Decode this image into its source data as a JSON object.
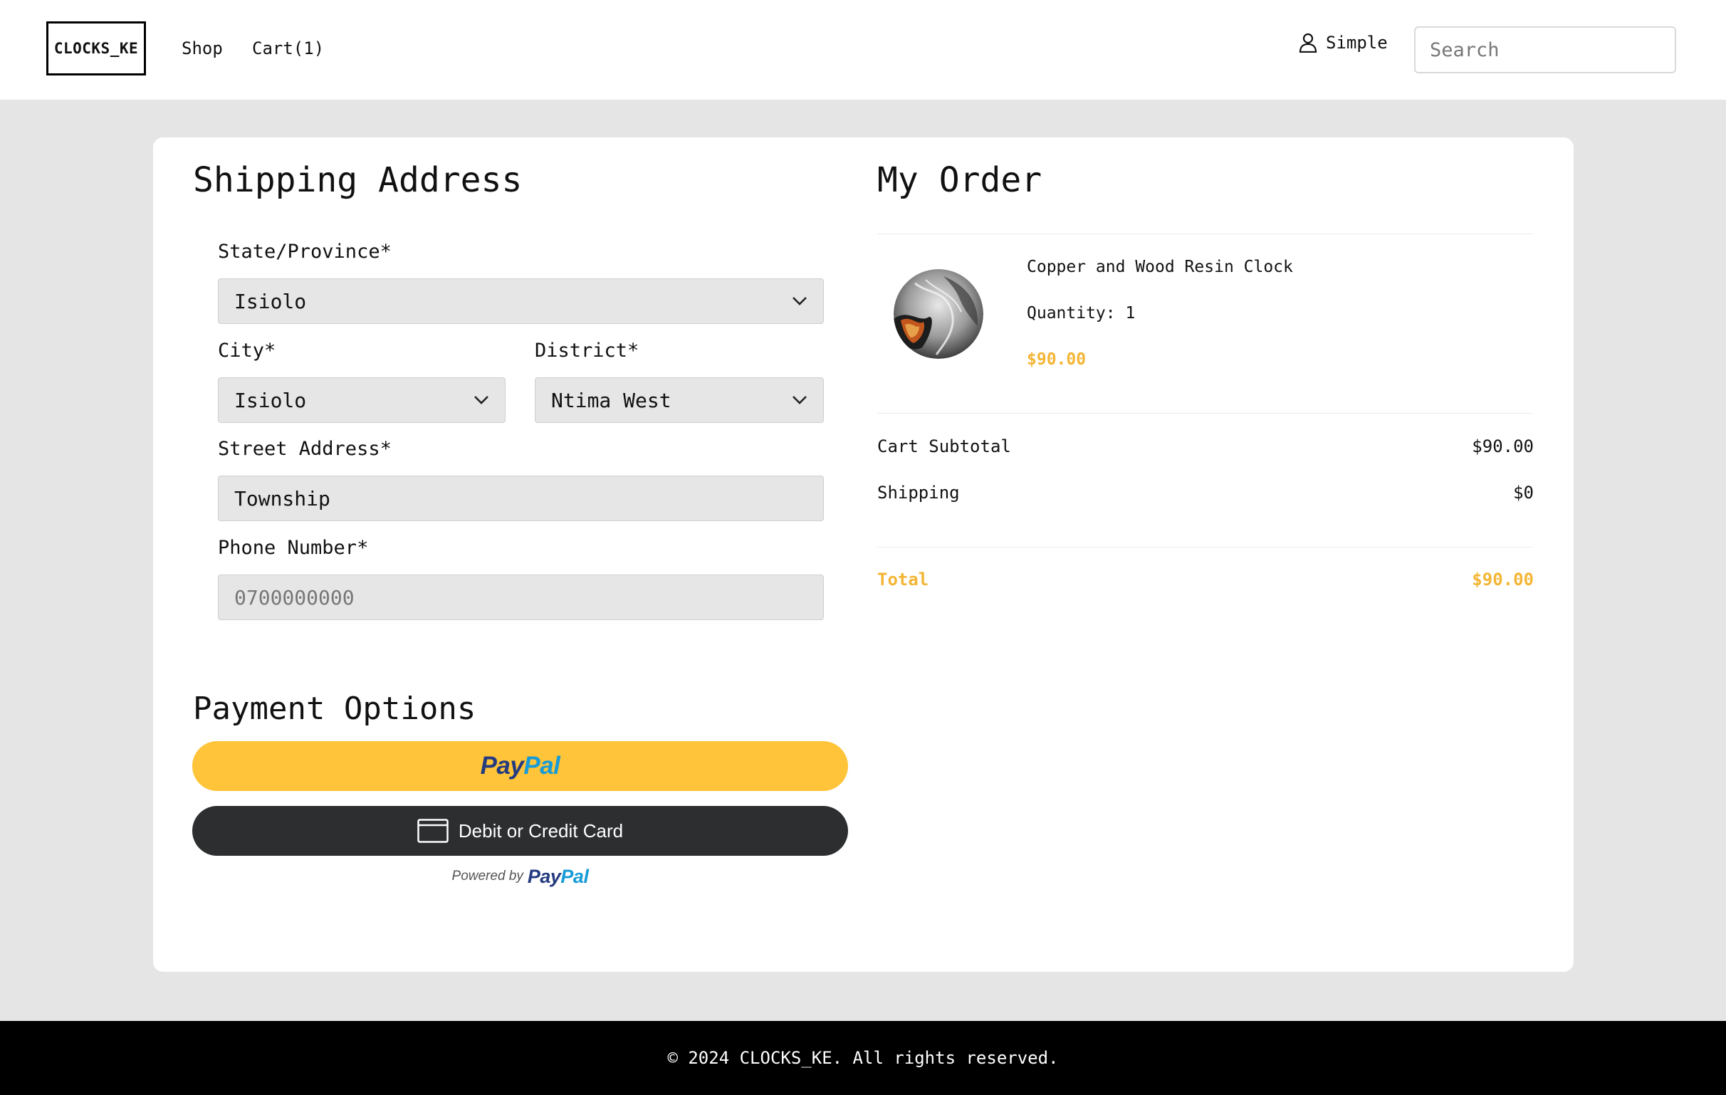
{
  "header": {
    "logo": "CLOCKS_KE",
    "nav": {
      "shop": "Shop",
      "cart": "Cart(1)"
    },
    "user_name": "Simple",
    "search_placeholder": "Search"
  },
  "shipping": {
    "title": "Shipping Address",
    "state_label": "State/Province*",
    "state_value": "Isiolo",
    "city_label": "City*",
    "city_value": "Isiolo",
    "district_label": "District*",
    "district_value": "Ntima West",
    "street_label": "Street Address*",
    "street_value": "Township",
    "phone_label": "Phone Number*",
    "phone_placeholder": "0700000000"
  },
  "payment": {
    "title": "Payment Options",
    "paypal_logo_part1": "Pay",
    "paypal_logo_part2": "Pal",
    "card_button_label": "Debit or Credit Card",
    "powered_by": "Powered by"
  },
  "order": {
    "title": "My Order",
    "item": {
      "name": "Copper and Wood Resin Clock",
      "quantity": "Quantity: 1",
      "price": "$90.00"
    },
    "subtotal_label": "Cart Subtotal",
    "subtotal_value": "$90.00",
    "shipping_label": "Shipping",
    "shipping_value": "$0",
    "total_label": "Total",
    "total_value": "$90.00"
  },
  "colors": {
    "accent": "#f4b534",
    "paypal_yellow": "#ffc439",
    "paypal_dark_blue": "#253b80",
    "paypal_light_blue": "#179bd7",
    "card_button": "#2c2e2f"
  },
  "footer": {
    "text": "© 2024 CLOCKS_KE. All rights reserved."
  }
}
